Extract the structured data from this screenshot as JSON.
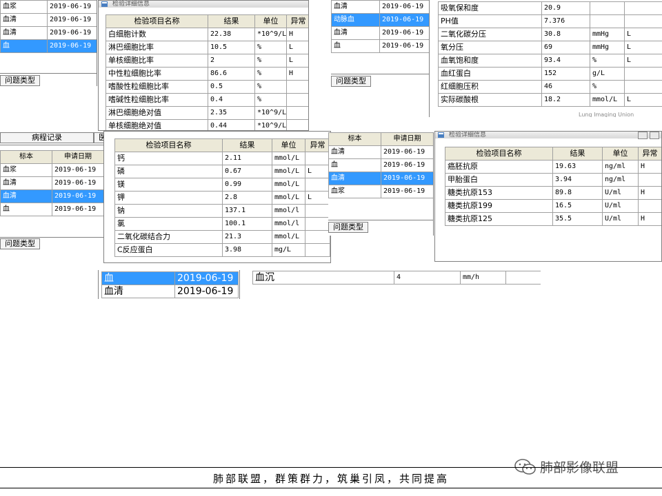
{
  "columns": {
    "specimen": "标本",
    "request_date": "申请日期",
    "test_name": "检验项目名称",
    "result": "结果",
    "unit": "单位",
    "abnormal": "异常"
  },
  "window_title": "检验详细信息",
  "issue_type_label": "问题类型",
  "medical_record_tab": "病程记录",
  "tab_partial": "医",
  "panel_top_left_specimens": {
    "rows": [
      {
        "specimen": "血浆",
        "date": "2019-06-19",
        "selected": false
      },
      {
        "specimen": "血清",
        "date": "2019-06-19",
        "selected": false
      },
      {
        "specimen": "血清",
        "date": "2019-06-19",
        "selected": false
      },
      {
        "specimen": "血",
        "date": "2019-06-19",
        "selected": true
      }
    ]
  },
  "panel_top_left_detail": {
    "rows": [
      {
        "name": "白细胞计数",
        "result": "22.38",
        "unit": "*10^9/L",
        "flag": "H"
      },
      {
        "name": "淋巴细胞比率",
        "result": "10.5",
        "unit": "%",
        "flag": "L"
      },
      {
        "name": "单核细胞比率",
        "result": "2",
        "unit": "%",
        "flag": "L"
      },
      {
        "name": "中性粒细胞比率",
        "result": "86.6",
        "unit": "%",
        "flag": "H"
      },
      {
        "name": "嗜酸性粒细胞比率",
        "result": "0.5",
        "unit": "%",
        "flag": ""
      },
      {
        "name": "嗜碱性粒细胞比率",
        "result": "0.4",
        "unit": "%",
        "flag": ""
      },
      {
        "name": "淋巴细胞绝对值",
        "result": "2.35",
        "unit": "*10^9/L",
        "flag": ""
      },
      {
        "name": "单核细胞绝对值",
        "result": "0.44",
        "unit": "*10^9/L",
        "flag": ""
      }
    ]
  },
  "panel_top_right_specimens": {
    "rows": [
      {
        "specimen": "血清",
        "date": "2019-06-19",
        "selected": false
      },
      {
        "specimen": "动脉血",
        "date": "2019-06-19",
        "selected": true
      },
      {
        "specimen": "血清",
        "date": "2019-06-19",
        "selected": false
      },
      {
        "specimen": "血",
        "date": "2019-06-19",
        "selected": false
      }
    ]
  },
  "panel_top_right_detail": {
    "rows": [
      {
        "name": "吸氧保和度",
        "result": "20.9",
        "unit": "",
        "flag": ""
      },
      {
        "name": "PH值",
        "result": "7.376",
        "unit": "",
        "flag": ""
      },
      {
        "name": "二氧化碳分压",
        "result": "30.8",
        "unit": "mmHg",
        "flag": "L"
      },
      {
        "name": "氧分压",
        "result": "69",
        "unit": "mmHg",
        "flag": "L"
      },
      {
        "name": "血氧饱和度",
        "result": "93.4",
        "unit": "%",
        "flag": "L"
      },
      {
        "name": "血红蛋白",
        "result": "152",
        "unit": "g/L",
        "flag": ""
      },
      {
        "name": "红细胞压积",
        "result": "46",
        "unit": "%",
        "flag": ""
      },
      {
        "name": "实际碳酸根",
        "result": "18.2",
        "unit": "mmol/L",
        "flag": "L"
      }
    ]
  },
  "panel_mid_left_specimens": {
    "rows": [
      {
        "specimen": "血浆",
        "date": "2019-06-19",
        "selected": false
      },
      {
        "specimen": "血清",
        "date": "2019-06-19",
        "selected": false
      },
      {
        "specimen": "血清",
        "date": "2019-06-19",
        "selected": true
      },
      {
        "specimen": "血",
        "date": "2019-06-19",
        "selected": false
      }
    ]
  },
  "panel_mid_left_detail": {
    "rows": [
      {
        "name": "钙",
        "result": "2.11",
        "unit": "mmol/L",
        "flag": ""
      },
      {
        "name": "磷",
        "result": "0.67",
        "unit": "mmol/L",
        "flag": "L"
      },
      {
        "name": "镁",
        "result": "0.99",
        "unit": "mmol/L",
        "flag": ""
      },
      {
        "name": "钾",
        "result": "2.8",
        "unit": "mmol/L",
        "flag": "L"
      },
      {
        "name": "钠",
        "result": "137.1",
        "unit": "mmol/l",
        "flag": ""
      },
      {
        "name": "氯",
        "result": "100.1",
        "unit": "mmol/l",
        "flag": ""
      },
      {
        "name": "二氧化碳结合力",
        "result": "21.3",
        "unit": "mmol/L",
        "flag": ""
      },
      {
        "name": "C反应蛋白",
        "result": "3.98",
        "unit": "mg/L",
        "flag": ""
      }
    ]
  },
  "panel_mid_right_specimens": {
    "rows": [
      {
        "specimen": "血清",
        "date": "2019-06-19",
        "selected": false
      },
      {
        "specimen": "血",
        "date": "2019-06-19",
        "selected": false
      },
      {
        "specimen": "血清",
        "date": "2019-06-19",
        "selected": true
      },
      {
        "specimen": "血浆",
        "date": "2019-06-19",
        "selected": false
      }
    ]
  },
  "panel_mid_right_detail": {
    "rows": [
      {
        "name": "癌胚抗原",
        "result": "19.63",
        "unit": "ng/ml",
        "flag": "H"
      },
      {
        "name": "甲胎蛋白",
        "result": "3.94",
        "unit": "ng/ml",
        "flag": ""
      },
      {
        "name": "糖类抗原153",
        "result": "89.8",
        "unit": "U/ml",
        "flag": "H"
      },
      {
        "name": "糖类抗原199",
        "result": "16.5",
        "unit": "U/ml",
        "flag": ""
      },
      {
        "name": "糖类抗原125",
        "result": "35.5",
        "unit": "U/ml",
        "flag": "H"
      }
    ]
  },
  "panel_bottom_specimens": {
    "rows": [
      {
        "specimen": "血",
        "date": "2019-06-19",
        "selected": true
      },
      {
        "specimen": "血清",
        "date": "2019-06-19",
        "selected": false
      }
    ]
  },
  "panel_bottom_detail": {
    "row": {
      "name": "血沉",
      "result": "4",
      "unit": "mm/h",
      "flag": ""
    }
  },
  "footer": {
    "slogan": "肺部联盟，群策群力，筑巢引凤，共同提高",
    "brand": "肺部影像联盟",
    "watermark": "Lung Imaging Union"
  },
  "colors": {
    "selection": "#3399ff",
    "flag": "#cc0000"
  }
}
